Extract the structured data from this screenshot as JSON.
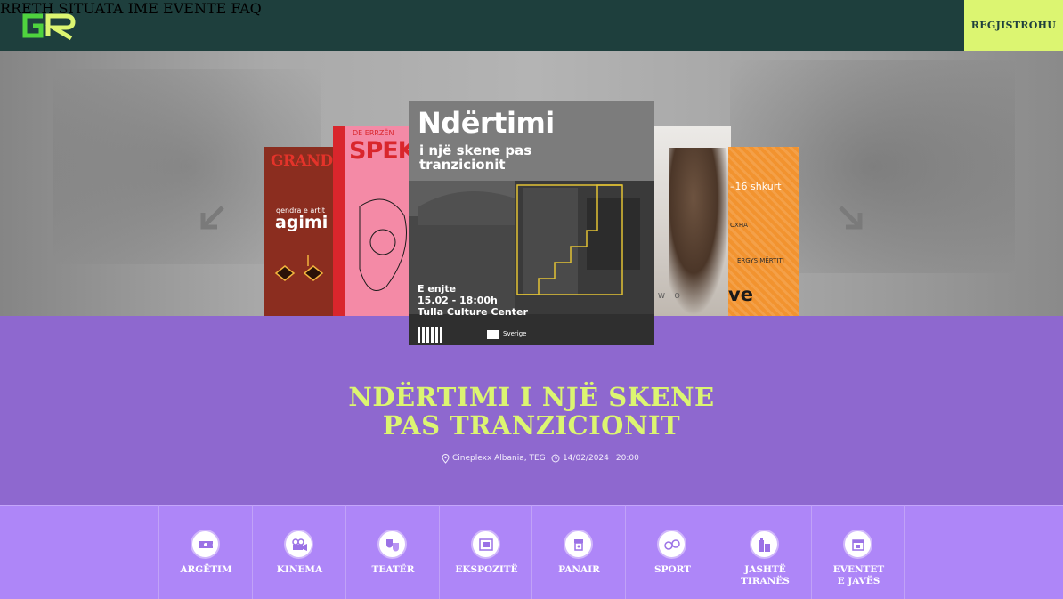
{
  "brand": {
    "logo_text": "GR"
  },
  "nav": {
    "items": [
      {
        "label": "RRETH"
      },
      {
        "label": "SITUATA IME"
      },
      {
        "label": "EVENTE"
      },
      {
        "label": "FAQ"
      }
    ],
    "register_label": "REGJISTROHU"
  },
  "carousel": {
    "featured": {
      "title": "Ndërtimi",
      "subtitle_line1": "i një skene pas",
      "subtitle_line2": "tranzicionit",
      "day": "E enjte",
      "date_time": "15.02 - 18:00h",
      "venue": "Tulla Culture Center",
      "sponsor_label": "Sverige"
    },
    "side_posters": {
      "agimi_top": "GRAND",
      "agimi_small": "qendra e artit",
      "agimi_name": "agimi",
      "spec_top": "DE ERRZËN",
      "spec_word": "SPEK",
      "photo_text": "W O",
      "orange_date": "–16 shkurt",
      "orange_name1": "OXHA",
      "orange_name2": "ERGYS MËRTITI",
      "orange_word": "ve"
    }
  },
  "event": {
    "title_line1": "NDËRTIMI I NJË SKENE",
    "title_line2": "PAS TRANZICIONIT",
    "location": "Cineplexx Albania, TEG",
    "date": "14/02/2024",
    "time": "20:00"
  },
  "categories": [
    {
      "label": "ARGËTIM",
      "icon": "ticket-icon"
    },
    {
      "label": "KINEMA",
      "icon": "camera-icon"
    },
    {
      "label": "TEATËR",
      "icon": "masks-icon"
    },
    {
      "label": "EKSPOZITË",
      "icon": "gallery-icon"
    },
    {
      "label": "PANAIR",
      "icon": "stand-icon"
    },
    {
      "label": "SPORT",
      "icon": "ball-icon"
    },
    {
      "label": "JASHTË\nTIRANËS",
      "icon": "city-icon"
    },
    {
      "label": "EVENTET\nE JAVËS",
      "icon": "calendar-icon"
    }
  ],
  "colors": {
    "header_bg": "#1e3f3d",
    "accent_lime": "#dcf571",
    "purple": "#8e68cf",
    "category_bar": "#ae86f8"
  }
}
